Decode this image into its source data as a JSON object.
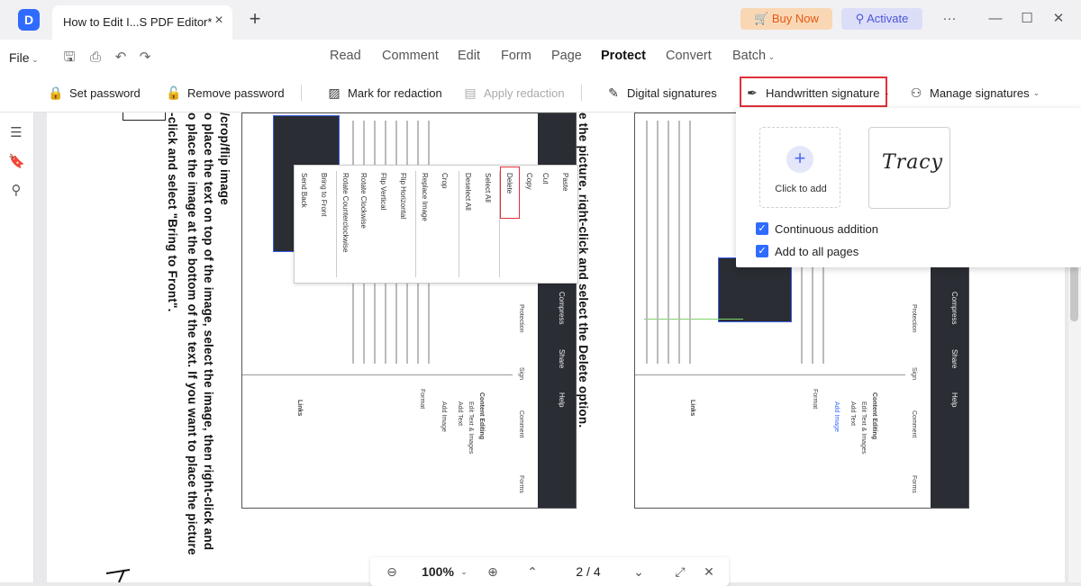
{
  "titlebar": {
    "tab_title": "How to Edit I...S PDF Editor*",
    "tab_close": "×",
    "new_tab": "+",
    "buy_now": "Buy Now",
    "activate": "Activate",
    "more": "···",
    "minimize": "—",
    "maximize": "☐",
    "close": "✕"
  },
  "menubar": {
    "file": "File",
    "items": [
      "Read",
      "Comment",
      "Edit",
      "Form",
      "Page",
      "Protect",
      "Convert",
      "Batch"
    ],
    "active": "Protect"
  },
  "ribbon": {
    "set_password": "Set password",
    "remove_password": "Remove password",
    "mark_for_redaction": "Mark for redaction",
    "apply_redaction": "Apply redaction",
    "digital_signatures": "Digital signatures",
    "handwritten_signature": "Handwritten signature",
    "manage_signatures": "Manage signatures"
  },
  "signature_panel": {
    "click_to_add": "Click to add",
    "signature_text": "Tracy",
    "continuous_addition": "Continuous addition",
    "add_to_all_pages": "Add to all pages",
    "continuous_addition_checked": true,
    "add_to_all_pages_checked": true
  },
  "page": {
    "col1": "/crop/flip image",
    "col2": "o place the text on top of the image, select the image, then right-click and",
    "col3": "o place the image at the bottom of the text. If you want to place the picture",
    "col4": "-click and select \"Bring to Front\".",
    "col5": "e the picture, right-click and select the Delete option.",
    "context_menu": [
      "Paste",
      "Copy",
      "Cut",
      "Delete",
      "Select All",
      "Deselect All",
      "Crop",
      "Replace Image",
      "Flip Horizontal",
      "Flip Vertical",
      "Rotate Clockwise",
      "Rotate Counterclockwise",
      "Bring to Front",
      "Send Back"
    ],
    "screenshot_sidebar": [
      "Protection",
      "Sign",
      "Comment",
      "Forms",
      "Compress",
      "Share",
      "Help"
    ],
    "screenshot_panel": [
      "Content Editing",
      "Edit Text & Images",
      "Add Text",
      "Add Image",
      "Format",
      "Links"
    ]
  },
  "zoombar": {
    "zoom": "100%",
    "page_indicator": "2 / 4"
  }
}
